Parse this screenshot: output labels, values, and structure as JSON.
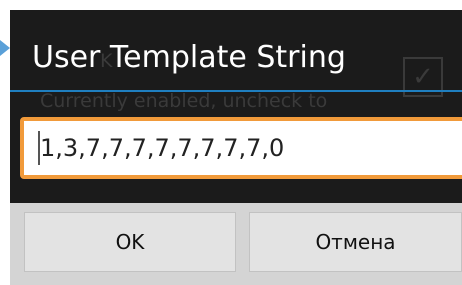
{
  "dialog": {
    "title": "User Template String",
    "input_value": "1,3,7,7,7,7,7,7,7,7,0",
    "ok_label": "OK",
    "cancel_label": "Отмена"
  },
  "background": {
    "row_title": "K",
    "row_summary": "Currently enabled, uncheck to",
    "checkbox_checked": true
  },
  "colors": {
    "dialog_bg": "#1b1b1b",
    "accent_blue": "#1f7fc0",
    "input_focus_border": "#f19a3a",
    "button_bg": "#e3e3e3"
  }
}
